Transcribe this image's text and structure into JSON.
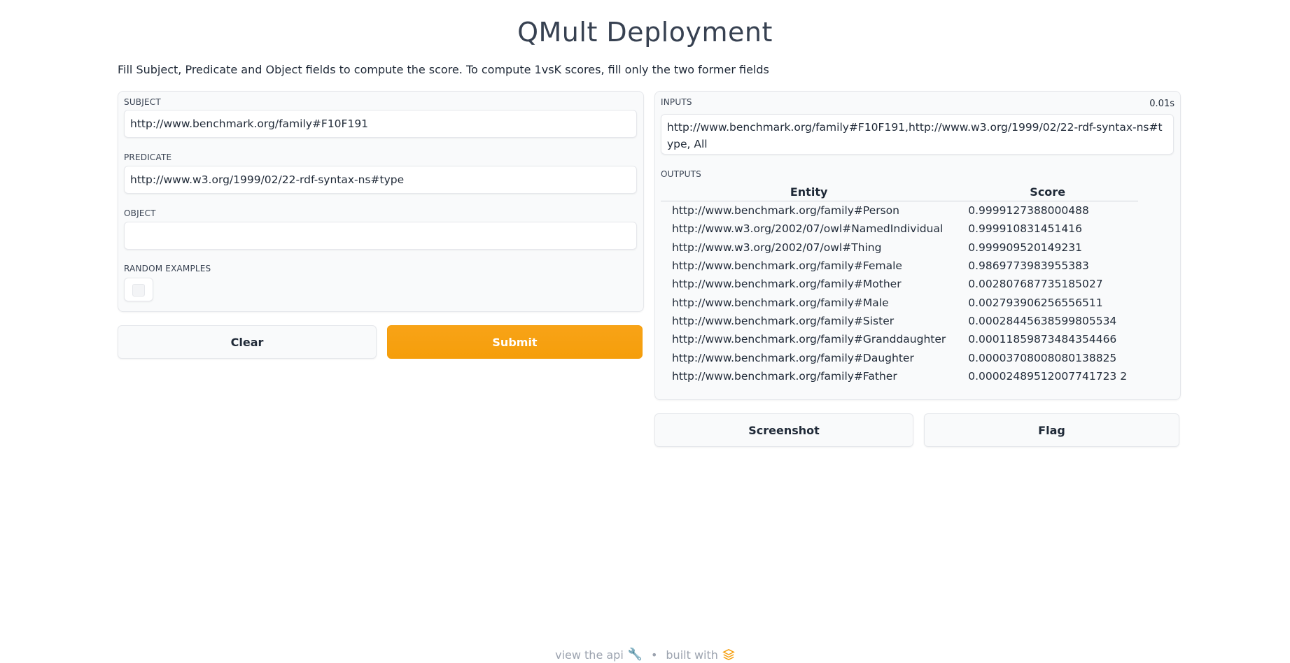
{
  "title": "QMult Deployment",
  "description": "Fill Subject, Predicate and Object fields to compute the score. To compute 1vsK scores, fill only the two former fields",
  "inputs_form": {
    "subject": {
      "label": "SUBJECT",
      "value": "http://www.benchmark.org/family#F10F191"
    },
    "predicate": {
      "label": "PREDICATE",
      "value": "http://www.w3.org/1999/02/22-rdf-syntax-ns#type"
    },
    "object": {
      "label": "OBJECT",
      "value": ""
    },
    "random_examples": {
      "label": "RANDOM EXAMPLES",
      "checked": false
    }
  },
  "buttons": {
    "clear": "Clear",
    "submit": "Submit",
    "screenshot": "Screenshot",
    "flag": "Flag"
  },
  "results": {
    "inputs_label": "INPUTS",
    "timer": "0.01s",
    "inputs_value": "http://www.benchmark.org/family#F10F191,http://www.w3.org/1999/02/22-rdf-syntax-ns#type, All",
    "outputs_label": "OUTPUTS",
    "table": {
      "headers": [
        "Entity",
        "Score"
      ],
      "rows": [
        [
          "http://www.benchmark.org/family#Person",
          "0.9999127388000488"
        ],
        [
          "http://www.w3.org/2002/07/owl#NamedIndividual",
          "0.999910831451416"
        ],
        [
          "http://www.w3.org/2002/07/owl#Thing",
          "0.999909520149231"
        ],
        [
          "http://www.benchmark.org/family#Female",
          "0.9869773983955383"
        ],
        [
          "http://www.benchmark.org/family#Mother",
          "0.002807687735185027"
        ],
        [
          "http://www.benchmark.org/family#Male",
          "0.002793906256556511"
        ],
        [
          "http://www.benchmark.org/family#Sister",
          "0.00028445638599805534"
        ],
        [
          "http://www.benchmark.org/family#Granddaughter",
          "0.00011859873484354466"
        ],
        [
          "http://www.benchmark.org/family#Daughter",
          "0.00003708008080138825"
        ],
        [
          "http://www.benchmark.org/family#Father",
          "0.00002489512007741723 2"
        ]
      ]
    }
  },
  "footer": {
    "view_api": "view the api",
    "separator": "•",
    "built_with": "built with",
    "api_icon": "wrench-icon",
    "logo_icon": "gradio-logo-icon"
  },
  "colors": {
    "accent": "#f59e0b",
    "panel_bg": "#f9fafb",
    "border": "#e5e7eb"
  }
}
